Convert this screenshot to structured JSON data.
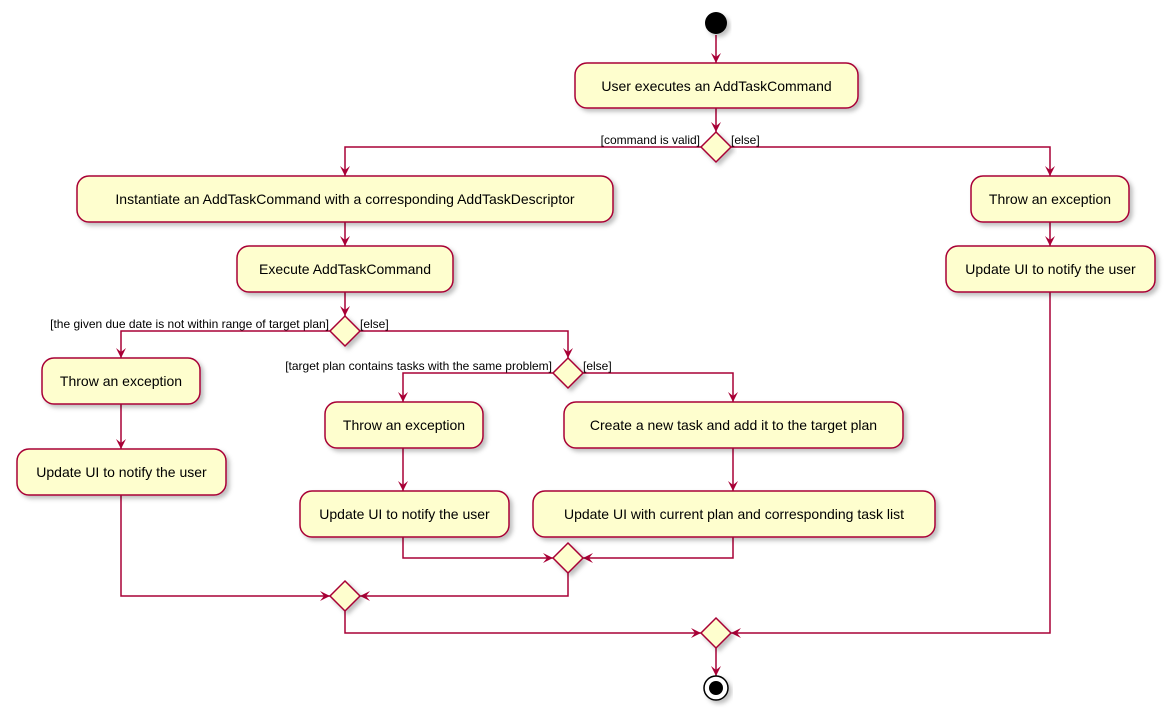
{
  "colors": {
    "fill": "#FEFECE",
    "border": "#A80036",
    "start_end": "#000000"
  },
  "nodes": {
    "user_executes": "User executes an AddTaskCommand",
    "instantiate": "Instantiate an AddTaskCommand with a corresponding AddTaskDescriptor",
    "execute": "Execute AddTaskCommand",
    "throw_invalid": "Throw an exception",
    "update_invalid": "Update UI to notify the user",
    "throw_date": "Throw an exception",
    "update_date": "Update UI to notify the user",
    "throw_duplicate": "Throw an exception",
    "update_duplicate": "Update UI to notify the user",
    "create_task": "Create a new task and add it to the target plan",
    "update_success": "Update UI with current plan and corresponding task list"
  },
  "guards": {
    "valid": "[command is valid]",
    "valid_else": "[else]",
    "date_out_of_range": "[the given due date is not within range of target plan]",
    "date_else": "[else]",
    "duplicate": "[target plan contains tasks with the same problem]",
    "duplicate_else": "[else]"
  }
}
